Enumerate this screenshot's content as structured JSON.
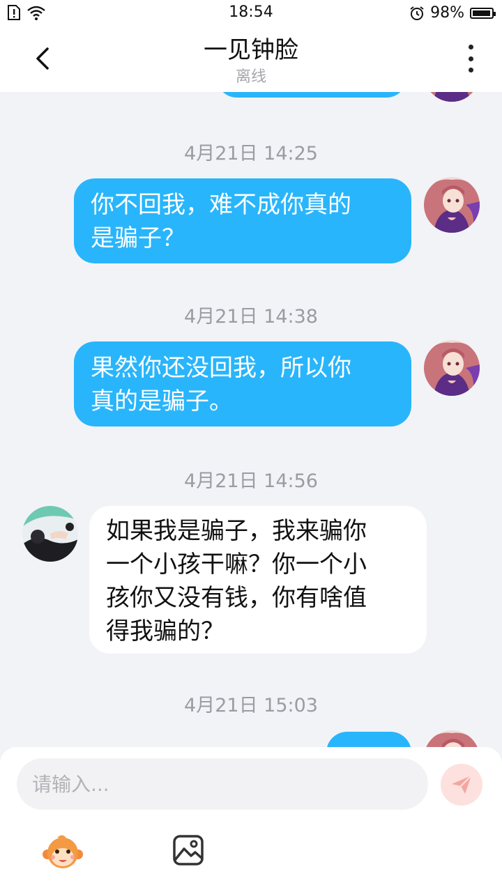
{
  "status_bar": {
    "time": "18:54",
    "battery": "98%",
    "battery_fraction": 0.98
  },
  "header": {
    "title": "一见钟脸",
    "subtitle": "离线"
  },
  "messages": [
    {
      "timestamp": "4月21日 14:25",
      "side": "me",
      "lines": [
        "你不回我，难不成你真的",
        "是骗子？"
      ]
    },
    {
      "timestamp": "4月21日 14:38",
      "side": "me",
      "lines": [
        "果然你还没回我，所以你",
        "真的是骗子。"
      ]
    },
    {
      "timestamp": "4月21日 14:56",
      "side": "them",
      "lines": [
        "如果我是骗子，我来骗你",
        "一个小孩干嘛？你一个小",
        "孩你又没有钱，你有啥值",
        "得我骗的？"
      ]
    },
    {
      "timestamp": "4月21日 15:03",
      "side": "me",
      "lines": []
    }
  ],
  "input": {
    "placeholder": "请输入..."
  },
  "icons": {
    "back": "chevron-left-icon",
    "more": "more-vertical-icon",
    "send": "paper-plane-icon",
    "emoji": "monkey-emoji-icon",
    "image": "image-icon"
  },
  "colors": {
    "my_bubble": "#29b5fb",
    "their_bubble": "#ffffff",
    "background": "#f2f3f7"
  }
}
